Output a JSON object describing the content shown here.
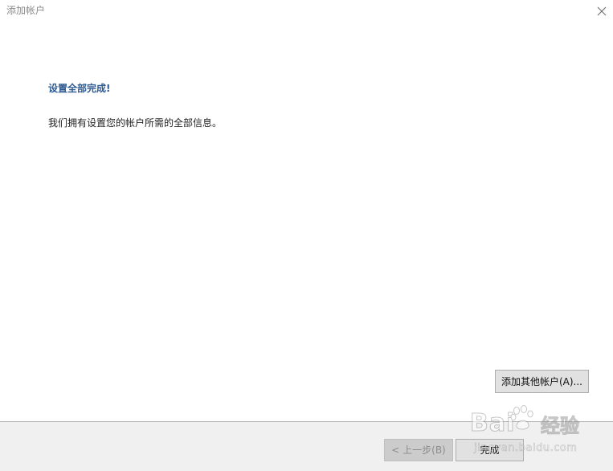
{
  "window": {
    "title": "添加帐户",
    "close_icon": "close-icon"
  },
  "content": {
    "heading": "设置全部完成!",
    "message": "我们拥有设置您的帐户所需的全部信息。"
  },
  "buttons": {
    "add_other_account": "添加其他帐户(A)...",
    "back": "< 上一步(B)",
    "finish": "完成"
  },
  "watermark": {
    "logo_text": "Bai",
    "logo_text_tail": "",
    "product": "经验",
    "url": "jingyan.baidu.com"
  },
  "colors": {
    "heading": "#2e5a92",
    "footer_bg": "#f0f0f0",
    "button_bg": "#e1e1e1",
    "button_disabled_bg": "#cccccc"
  }
}
